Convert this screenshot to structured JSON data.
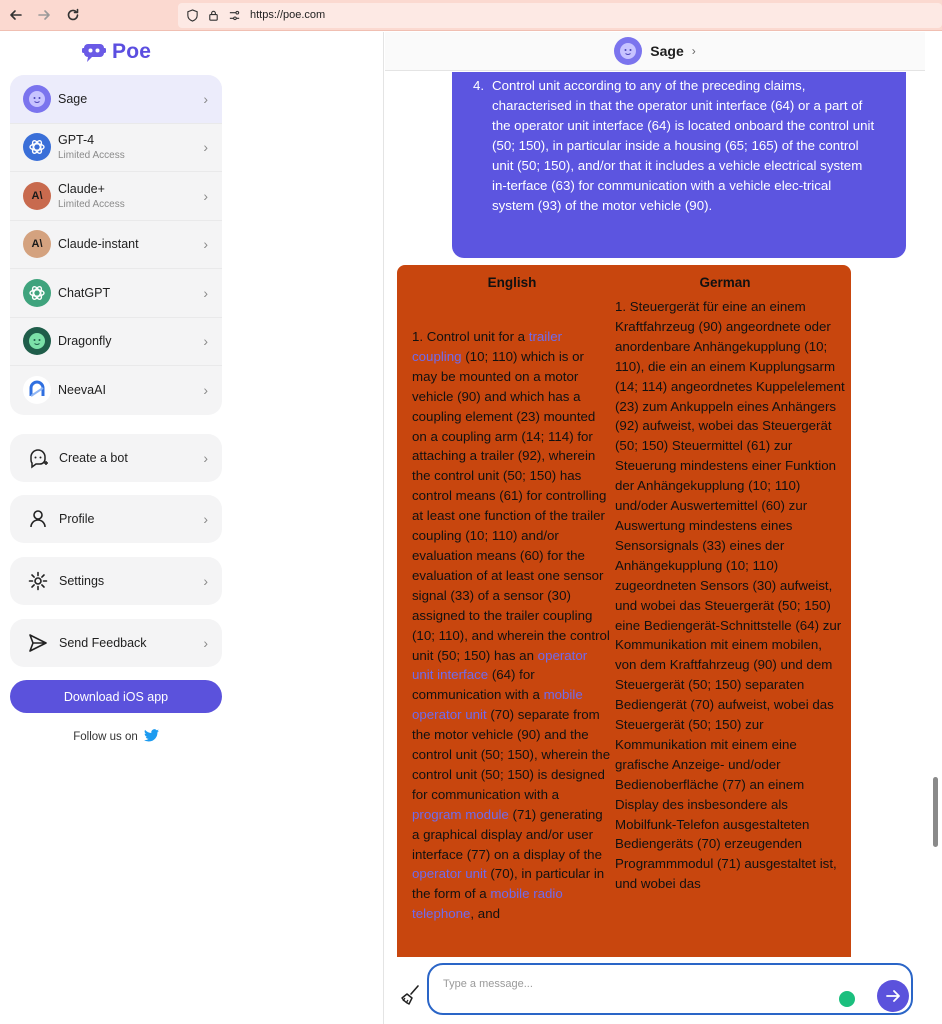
{
  "browser": {
    "url": "https://poe.com"
  },
  "sidebar": {
    "logo_text": "Poe",
    "bots": [
      {
        "name": "Sage",
        "sub": ""
      },
      {
        "name": "GPT-4",
        "sub": "Limited Access"
      },
      {
        "name": "Claude+",
        "sub": "Limited Access"
      },
      {
        "name": "Claude-instant",
        "sub": ""
      },
      {
        "name": "ChatGPT",
        "sub": ""
      },
      {
        "name": "Dragonfly",
        "sub": ""
      },
      {
        "name": "NeevaAI",
        "sub": ""
      }
    ],
    "menu": {
      "create_bot": "Create a bot",
      "profile": "Profile",
      "settings": "Settings",
      "feedback": "Send Feedback"
    },
    "download_label": "Download iOS app",
    "follow_label": "Follow us on"
  },
  "chat": {
    "header_name": "Sage",
    "user_message": {
      "number": "4.",
      "text": "Control unit according to any of the preceding claims, characterised in that the operator unit interface (64) or a part of the operator unit interface (64) is located onboard the control unit (50; 150), in particular inside a housing (65; 165) of the control unit (50; 150), and/or that it includes a vehicle electrical system in-terface (63) for communication with a vehicle elec-trical system (93) of the motor vehicle (90)."
    },
    "bot_message": {
      "col_en_title": "English",
      "col_de_title": "German",
      "en": {
        "p1": "1. Control unit for a ",
        "l1": "trailer coupling",
        "p2": " (10; 110) which is or may be mounted on a motor vehicle (90) and which has a coupling element (23) mounted on a coupling arm (14; 114) for attaching a trailer (92), wherein the control unit (50; 150) has control means (61) for controlling at least one function of the trailer coupling (10; 110) and/or evaluation means (60) for the evaluation of at least one sensor signal (33) of a sensor (30) assigned to the trailer coupling (10; 110), and wherein the control unit (50; 150) has an ",
        "l2": "operator unit interface",
        "p3": " (64) for communication with a ",
        "l3": "mobile operator unit",
        "p4": " (70) separate from the motor vehicle (90) and the control unit (50; 150), wherein the control unit (50; 150) is designed for communication with a ",
        "l4": "program module",
        "p5": " (71) generating a graphical display and/or user interface (77) on a display of the ",
        "l5": "operator unit",
        "p6": " (70), in particular in the form of a ",
        "l6": "mobile radio telephone",
        "p7": ", and"
      },
      "de": "1. Steuergerät für eine an einem Kraftfahrzeug (90) angeordnete oder anordenbare Anhängekupplung (10; 110), die ein an einem Kupplungsarm (14; 114) angeordnetes Kuppelelement (23) zum Ankuppeln eines Anhängers (92) aufweist, wobei das Steuergerät (50; 150) Steuermittel (61) zur Steuerung mindestens einer Funktion der Anhängekupplung (10; 110) und/oder Auswertemittel (60) zur Auswertung mindestens eines Sensorsignals (33) eines der Anhängekupplung (10; 110) zugeordneten Sensors (30) aufweist, und wobei das Steuergerät (50; 150) eine Bediengerät-Schnittstelle (64) zur Kommunikation mit einem mobilen, von dem Kraftfahrzeug (90) und dem Steuergerät (50; 150) separaten Bediengerät (70) aufweist, wobei das Steuergerät (50; 150) zur Kommunikation mit einem eine grafische Anzeige- und/oder Bedienoberfläche (77) an einem Display des insbesondere als Mobilfunk-Telefon ausgestalteten Bediengeräts (70) erzeugenden Programmmodul (71) ausgestaltet ist, und wobei das"
    },
    "input_placeholder": "Type a message..."
  },
  "colors": {
    "accent": "#5b52dc",
    "user_bubble": "#5c55e0",
    "bot_bubble": "#c8460e",
    "browser_bar": "#fbd9d0"
  }
}
